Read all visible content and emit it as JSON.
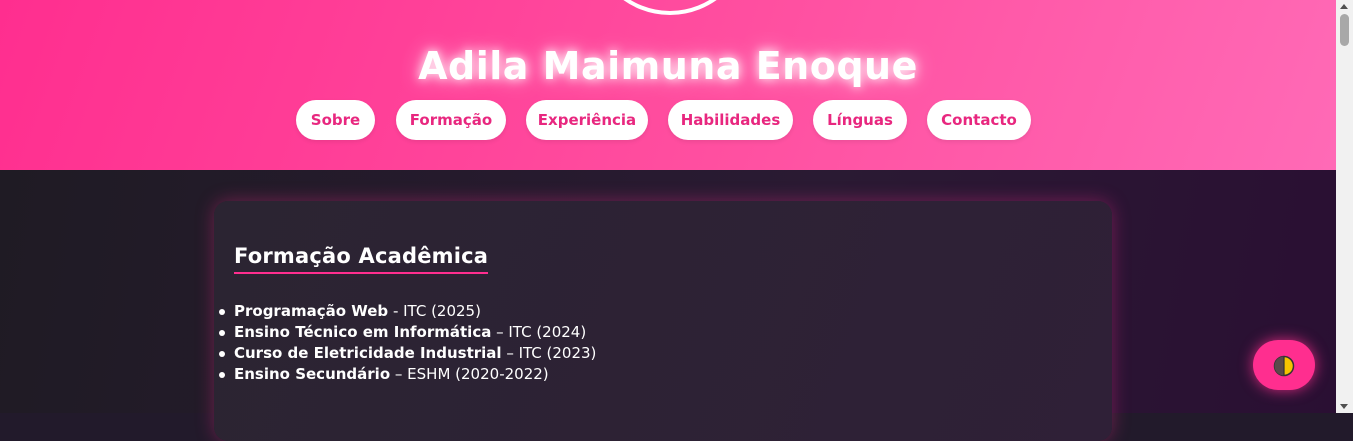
{
  "header": {
    "name": "Adila Maimuna Enoque",
    "nav": [
      {
        "label": "Sobre"
      },
      {
        "label": "Formação"
      },
      {
        "label": "Experiência"
      },
      {
        "label": "Habilidades"
      },
      {
        "label": "Línguas"
      },
      {
        "label": "Contacto"
      }
    ]
  },
  "section": {
    "title": "Formação Acadêmica",
    "items": [
      {
        "course": "Programação Web",
        "detail": " - ITC (2025)"
      },
      {
        "course": "Ensino Técnico em Informática",
        "detail": " – ITC (2024)"
      },
      {
        "course": "Curso de Eletricidade Industrial",
        "detail": " – ITC (2023)"
      },
      {
        "course": "Ensino Secundário",
        "detail": " – ESHM (2020-2022)"
      }
    ]
  },
  "theme_toggle": {
    "icon": "half-moon-icon"
  },
  "colors": {
    "accent": "#ff2e8f",
    "background": "#221a2b",
    "nav_text": "#e8277f"
  }
}
